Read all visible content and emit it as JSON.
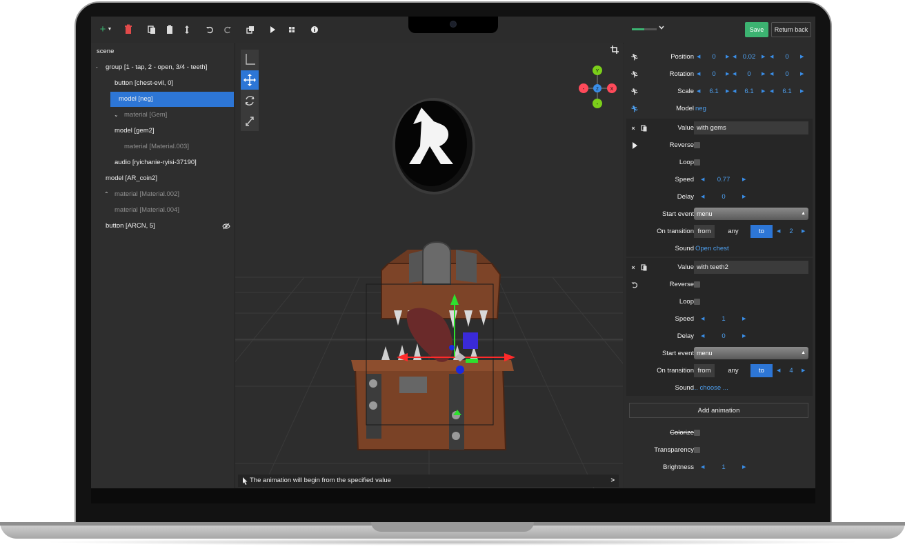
{
  "toolbar": {
    "icons": [
      "plus-icon",
      "chevron-down-icon",
      "trash-icon",
      "copy-icon",
      "paste-icon",
      "move-vertical-icon",
      "undo-icon",
      "redo-icon",
      "duplicate-icon",
      "play-icon",
      "grid-icon",
      "info-icon"
    ],
    "progress": 0.5,
    "save_label": "Save",
    "return_label": "Return back"
  },
  "scene": {
    "root_label": "scene",
    "items": [
      {
        "label": "group [1 - tap, 2 - open, 3/4 - teeth]",
        "indent": 1,
        "toggle": "-",
        "dim": false
      },
      {
        "label": "button [chest-evil, 0]",
        "indent": 2,
        "dim": false
      },
      {
        "label": "model [neg]",
        "indent": 2,
        "dim": false,
        "selected": true
      },
      {
        "label": "material [Gem]",
        "indent": 3,
        "toggle": "v",
        "dim": true
      },
      {
        "label": "model [gem2]",
        "indent": 2,
        "dim": false
      },
      {
        "label": "material [Material.003]",
        "indent": 3,
        "dim": true
      },
      {
        "label": "audio [ryichanie-ryisi-37190]",
        "indent": 2,
        "dim": false
      },
      {
        "label": "model [AR_coin2]",
        "indent": 1,
        "dim": false
      },
      {
        "label": "material [Material.002]",
        "indent": 2,
        "toggle": "^",
        "dim": true
      },
      {
        "label": "material [Material.004]",
        "indent": 2,
        "dim": true
      },
      {
        "label": "button [ARCN, 5]",
        "indent": 1,
        "dim": false,
        "hidden_icon": true
      }
    ]
  },
  "viewport": {
    "gizmo_axes": {
      "y": "Y",
      "x": "X",
      "z": "Z",
      "neg_x": "-",
      "neg_y": "-"
    },
    "status_text": "The animation will begin from the specified value",
    "status_expand": ">"
  },
  "transform": {
    "position_label": "Position",
    "position": [
      "0",
      "0.02",
      "0"
    ],
    "rotation_label": "Rotation",
    "rotation": [
      "0",
      "0",
      "0"
    ],
    "scale_label": "Scale",
    "scale": [
      "6.1",
      "6.1",
      "6.1"
    ],
    "model_label": "Model",
    "model_value": "neg"
  },
  "animations": [
    {
      "value_label": "Value",
      "value": "with gems",
      "reverse_label": "Reverse",
      "loop_label": "Loop",
      "speed_label": "Speed",
      "speed": "0.77",
      "delay_label": "Delay",
      "delay": "0",
      "start_event_label": "Start event",
      "start_event": "menu",
      "transition_label": "On transition",
      "from": "from",
      "any": "any",
      "to": "to",
      "to_value": "2",
      "sound_label": "Sound",
      "sound": "Open chest"
    },
    {
      "value_label": "Value",
      "value": "with teeth2",
      "reverse_label": "Reverse",
      "loop_label": "Loop",
      "speed_label": "Speed",
      "speed": "1",
      "delay_label": "Delay",
      "delay": "0",
      "start_event_label": "Start event",
      "start_event": "menu",
      "transition_label": "On transition",
      "from": "from",
      "any": "any",
      "to": "to",
      "to_value": "4",
      "sound_label": "Sound",
      "sound": "... choose ..."
    }
  ],
  "add_animation_label": "Add animation",
  "material": {
    "colorize_label": "Colorize",
    "transparency_label": "Transparency",
    "brightness_label": "Brightness",
    "brightness": "1"
  },
  "colors": {
    "accent": "#2d76d6",
    "save": "#3cb371",
    "link": "#4ea0f0"
  }
}
